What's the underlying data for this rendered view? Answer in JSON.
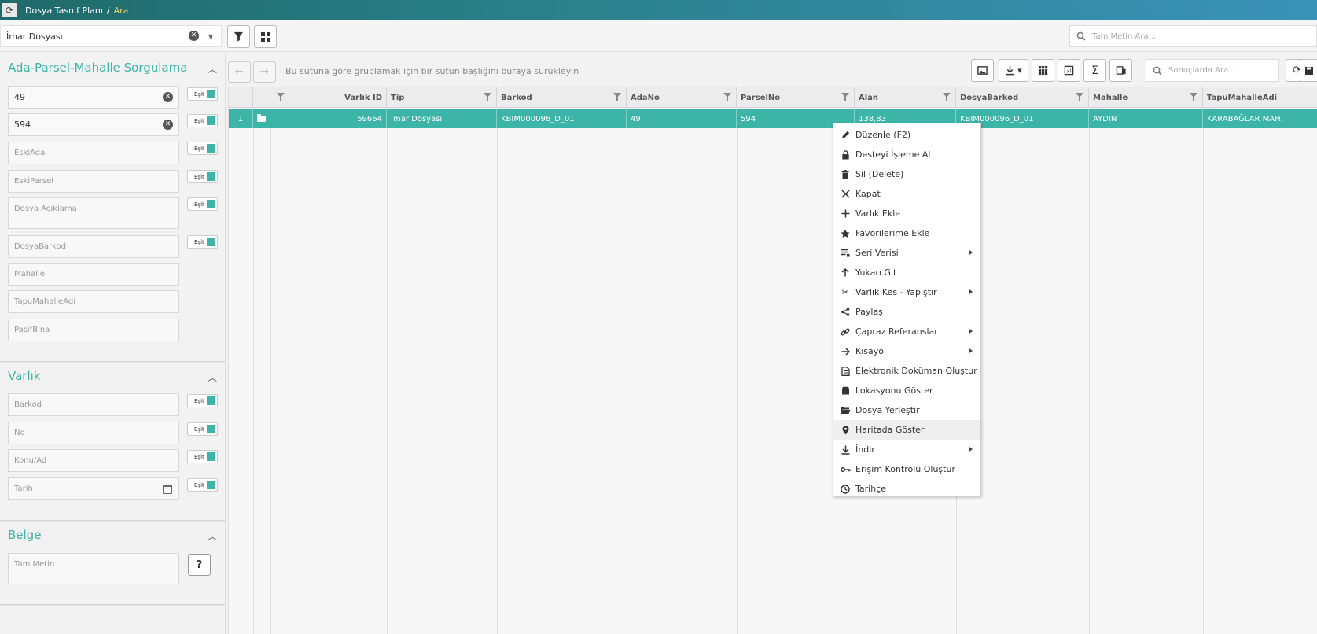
{
  "titlebar": {
    "breadcrumb_root": "Dosya Tasnif Planı",
    "separator": "/",
    "breadcrumb_current": "Ara"
  },
  "toolbar": {
    "type_value": "İmar Dosyası",
    "fulltext_placeholder": "Tam Metin Ara..."
  },
  "left_panel": {
    "ada_section": {
      "title": "Ada-Parsel-Mahalle Sorgulama",
      "ada_value": "49",
      "parsel_value": "594",
      "eski_ada_placeholder": "EskiAda",
      "eski_parsel_placeholder": "EskiParsel",
      "aciklama_placeholder": "Dosya Açıklama",
      "barkod_placeholder": "DosyaBarkod",
      "mahalle_placeholder": "Mahalle",
      "tapu_placeholder": "TapuMahalleAdi",
      "pasif_placeholder": "PasifBina",
      "toggle_label": "Eşit"
    },
    "varlik_section": {
      "title": "Varlık",
      "barkod_placeholder": "Barkod",
      "no_placeholder": "No",
      "konu_placeholder": "Konu/Ad",
      "tarih_placeholder": "Tarih",
      "toggle_label": "Eşit"
    },
    "belge_section": {
      "title": "Belge",
      "fulltext_placeholder": "Tam Metin",
      "help_label": "?"
    }
  },
  "grid_toolbar": {
    "back_icon": "←",
    "forward_icon": "→",
    "group_hint": "Bu sütuna göre gruplamak için bir sütun başlığını buraya sürükleyin",
    "result_search_placeholder": "Sonuçlarda Ara..."
  },
  "grid": {
    "columns": [
      "Varlık ID",
      "Tip",
      "Barkod",
      "AdaNo",
      "ParselNo",
      "Alan",
      "DosyaBarkod",
      "Mahalle",
      "TapuMahalleAdi"
    ],
    "row": {
      "index": "1",
      "varlik_id": "59664",
      "tip": "İmar Dosyası",
      "barkod": "KBIM000096_D_01",
      "ada_no": "49",
      "parsel_no": "594",
      "alan": "138,83",
      "dosya_barkod": "KBIM000096_D_01",
      "mahalle": "AYDIN",
      "tapu_mahalle": "KARABAĞLAR MAH."
    }
  },
  "context_menu": {
    "items": [
      {
        "label": "Düzenle (F2)",
        "icon": "pencil-icon"
      },
      {
        "label": "Desteyi İşleme Al",
        "icon": "lock-icon"
      },
      {
        "label": "Sil (Delete)",
        "icon": "trash-icon"
      },
      {
        "label": "Kapat",
        "icon": "close-icon"
      },
      {
        "label": "Varlık Ekle",
        "icon": "plus-icon"
      },
      {
        "label": "Favorilerime Ekle",
        "icon": "star-icon"
      },
      {
        "label": "Seri Verisi",
        "icon": "list-icon"
      },
      {
        "label": "Yukarı Git",
        "icon": "arrow-up-icon"
      },
      {
        "label": "Varlık Kes - Yapıştır",
        "icon": "scissors-icon"
      },
      {
        "label": "Paylaş",
        "icon": "share-icon"
      },
      {
        "label": "Çapraz Referanslar",
        "icon": "link-icon"
      },
      {
        "label": "Kısayol",
        "icon": "arrow-right-icon"
      },
      {
        "label": "Elektronik Doküman Oluştur",
        "icon": "document-icon"
      },
      {
        "label": "Lokasyonu Göster",
        "icon": "box-icon"
      },
      {
        "label": "Dosya Yerleştir",
        "icon": "folder-open-icon"
      },
      {
        "label": "Haritada Göster",
        "icon": "map-marker-icon"
      },
      {
        "label": "İndir",
        "icon": "download-icon"
      },
      {
        "label": "Erişim Kontrolü Oluştur",
        "icon": "key-icon"
      },
      {
        "label": "Tarihçe",
        "icon": "clock-icon"
      }
    ]
  },
  "colors": {
    "accent": "#3cb5a8",
    "titlebar_start": "#1f6a6a",
    "titlebar_end": "#3a92b8",
    "breadcrumb_active": "#f6d36a"
  }
}
